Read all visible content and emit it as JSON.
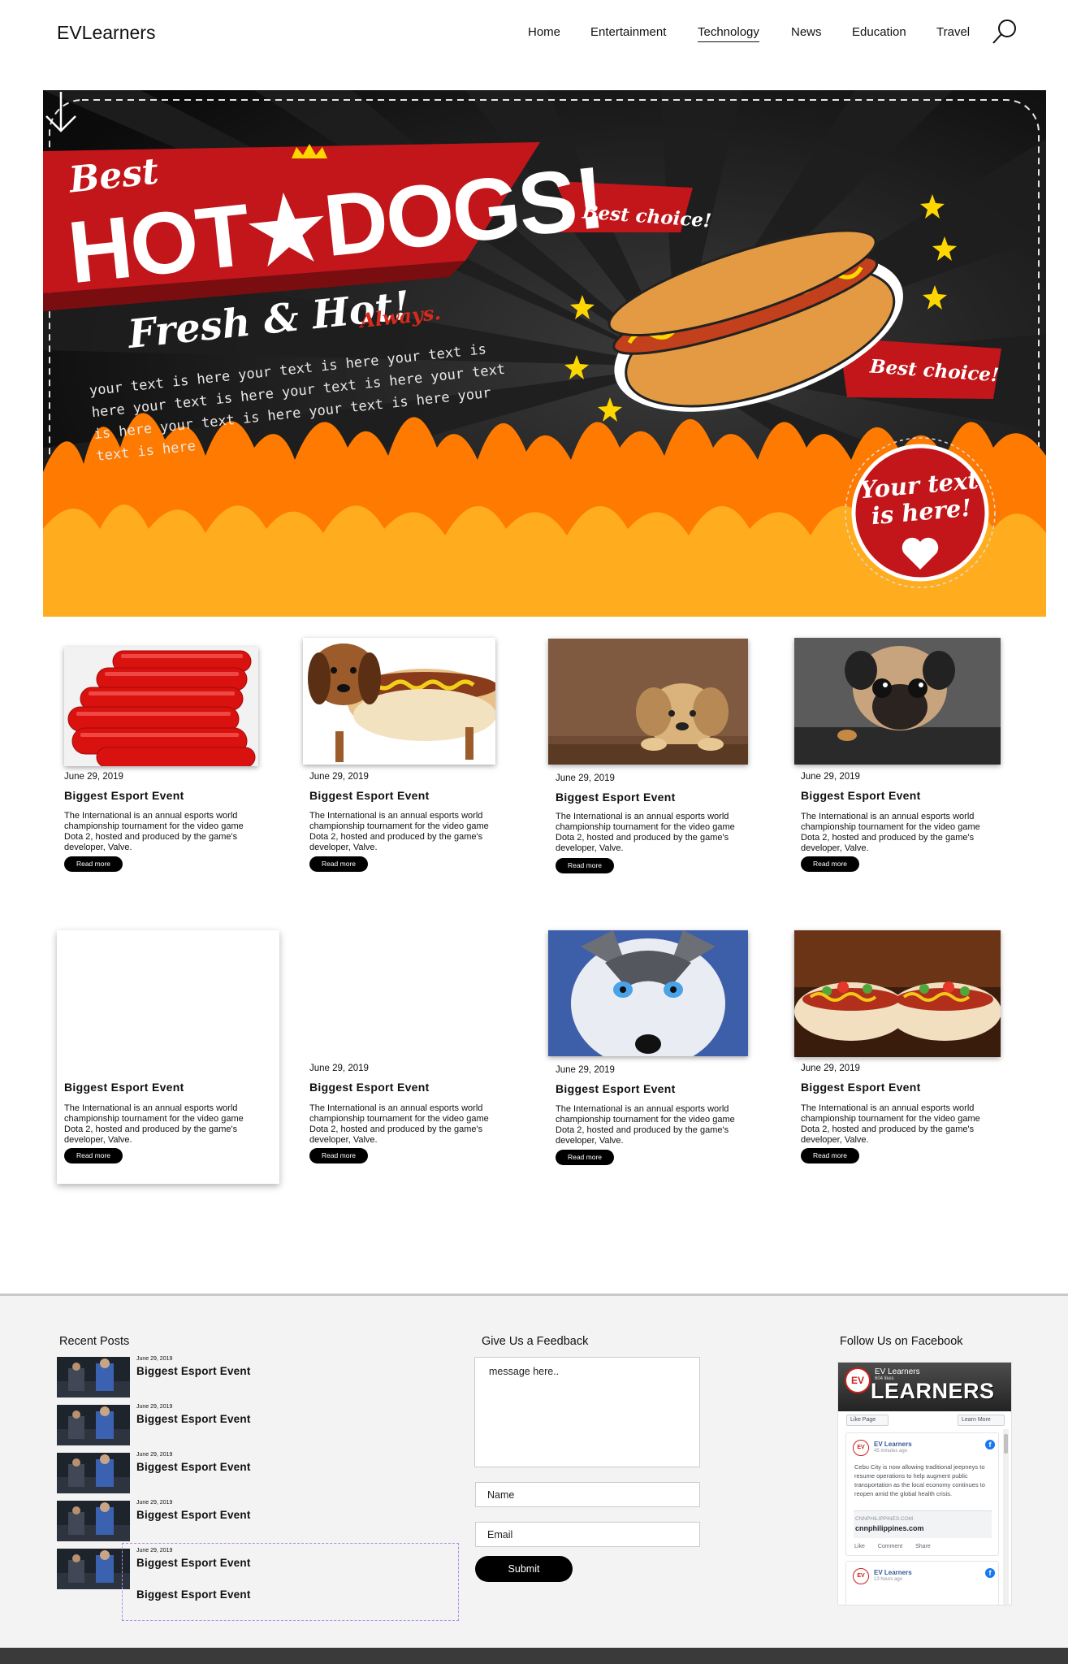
{
  "header": {
    "logo": "EVLearners",
    "nav": [
      {
        "label": "Home"
      },
      {
        "label": "Entertainment"
      },
      {
        "label": "Technology",
        "active": true
      },
      {
        "label": "News"
      },
      {
        "label": "Education"
      },
      {
        "label": "Travel"
      }
    ],
    "search_icon": "search-icon"
  },
  "hero": {
    "best": "Best",
    "title": "HOT★DOGS!",
    "fresh": "Fresh & Hot!",
    "always": "Always.",
    "lorem": "your text is here your text is here your text is here your text is here your text is here your text is here your text is here your text is here your text is here",
    "ribbon_1": "Best choice!",
    "ribbon_2": "Best choice!",
    "badge": "Your text is here!",
    "colors": {
      "red": "#c2161b",
      "orange": "#ff7a00",
      "yellow": "#ffd700",
      "bun": "#e39a43"
    }
  },
  "cards": [
    {
      "date": "June 29, 2019",
      "title": "Biggest Esport Event",
      "desc": "The International is an annual esports world championship tournament for the video game Dota 2, hosted and produced by the game's developer, Valve.",
      "button": "Read more",
      "image": "sausages"
    },
    {
      "date": "June 29, 2019",
      "title": "Biggest Esport Event",
      "desc": "The International is an annual esports world championship tournament for the video game Dota 2, hosted and produced by the game's developer, Valve.",
      "button": "Read more",
      "image": "dachshund-hotdog"
    },
    {
      "date": "June 29, 2019",
      "title": "Biggest Esport Event",
      "desc": "The International is an annual esports world championship tournament for the video game Dota 2, hosted and produced by the game's developer, Valve.",
      "button": "Read more",
      "image": "golden-puppy"
    },
    {
      "date": "June 29, 2019",
      "title": "Biggest Esport Event",
      "desc": "The International is an annual esports world championship tournament for the video game Dota 2, hosted and produced by the game's developer, Valve.",
      "button": "Read more",
      "image": "pug"
    },
    {
      "date": "",
      "title": "Biggest Esport Event",
      "desc": "The International is an annual esports world championship tournament for the video game Dota 2, hosted and produced by the game's developer, Valve.",
      "button": "Read more",
      "image": ""
    },
    {
      "date": "June 29, 2019",
      "title": "Biggest Esport Event",
      "desc": "The International is an annual esports world championship tournament for the video game Dota 2, hosted and produced by the game's developer, Valve.",
      "button": "Read more",
      "image": ""
    },
    {
      "date": "June 29, 2019",
      "title": "Biggest Esport Event",
      "desc": "The International is an annual esports world championship tournament for the video game Dota 2, hosted and produced by the game's developer, Valve.",
      "button": "Read more",
      "image": "husky"
    },
    {
      "date": "June 29, 2019",
      "title": "Biggest Esport Event",
      "desc": "The International is an annual esports world championship tournament for the video game Dota 2, hosted and produced by the game's developer, Valve.",
      "button": "Read more",
      "image": "hotdogs"
    }
  ],
  "footer": {
    "recent_heading": "Recent Posts",
    "recent_posts": [
      {
        "date": "June 29, 2019",
        "title": "Biggest Esport Event"
      },
      {
        "date": "June 29, 2019",
        "title": "Biggest Esport Event"
      },
      {
        "date": "June 29, 2019",
        "title": "Biggest Esport Event"
      },
      {
        "date": "June 29, 2019",
        "title": "Biggest Esport Event"
      },
      {
        "date": "June 29, 2019",
        "title": "Biggest Esport Event"
      }
    ],
    "extra_post_title": "Biggest Esport Event",
    "feedback_heading": "Give Us a Feedback",
    "message_placeholder": "message here..",
    "name_placeholder": "Name",
    "email_placeholder": "Email",
    "submit_label": "Submit",
    "facebook_heading": "Follow Us on Facebook"
  },
  "facebook_widget": {
    "page_name": "EV Learners",
    "likes": "604 likes",
    "brand": "LEARNERS",
    "logo": "EV",
    "like_button": "Like Page",
    "learn_button": "Learn More",
    "post_author": "EV Learners",
    "post_time": "45 minutes ago",
    "post_body": "Cebu City is now allowing traditional jeepneys to resume operations to help augment public transportation as the local economy continues to reopen amid the global health crisis.",
    "link_domain": "CNNPHILIPPINES.COM",
    "link_title": "cnnphilippines.com",
    "action_like": "Like",
    "action_comment": "Comment",
    "action_share": "Share",
    "post2_author": "EV Learners",
    "post2_time": "13 hours ago"
  }
}
